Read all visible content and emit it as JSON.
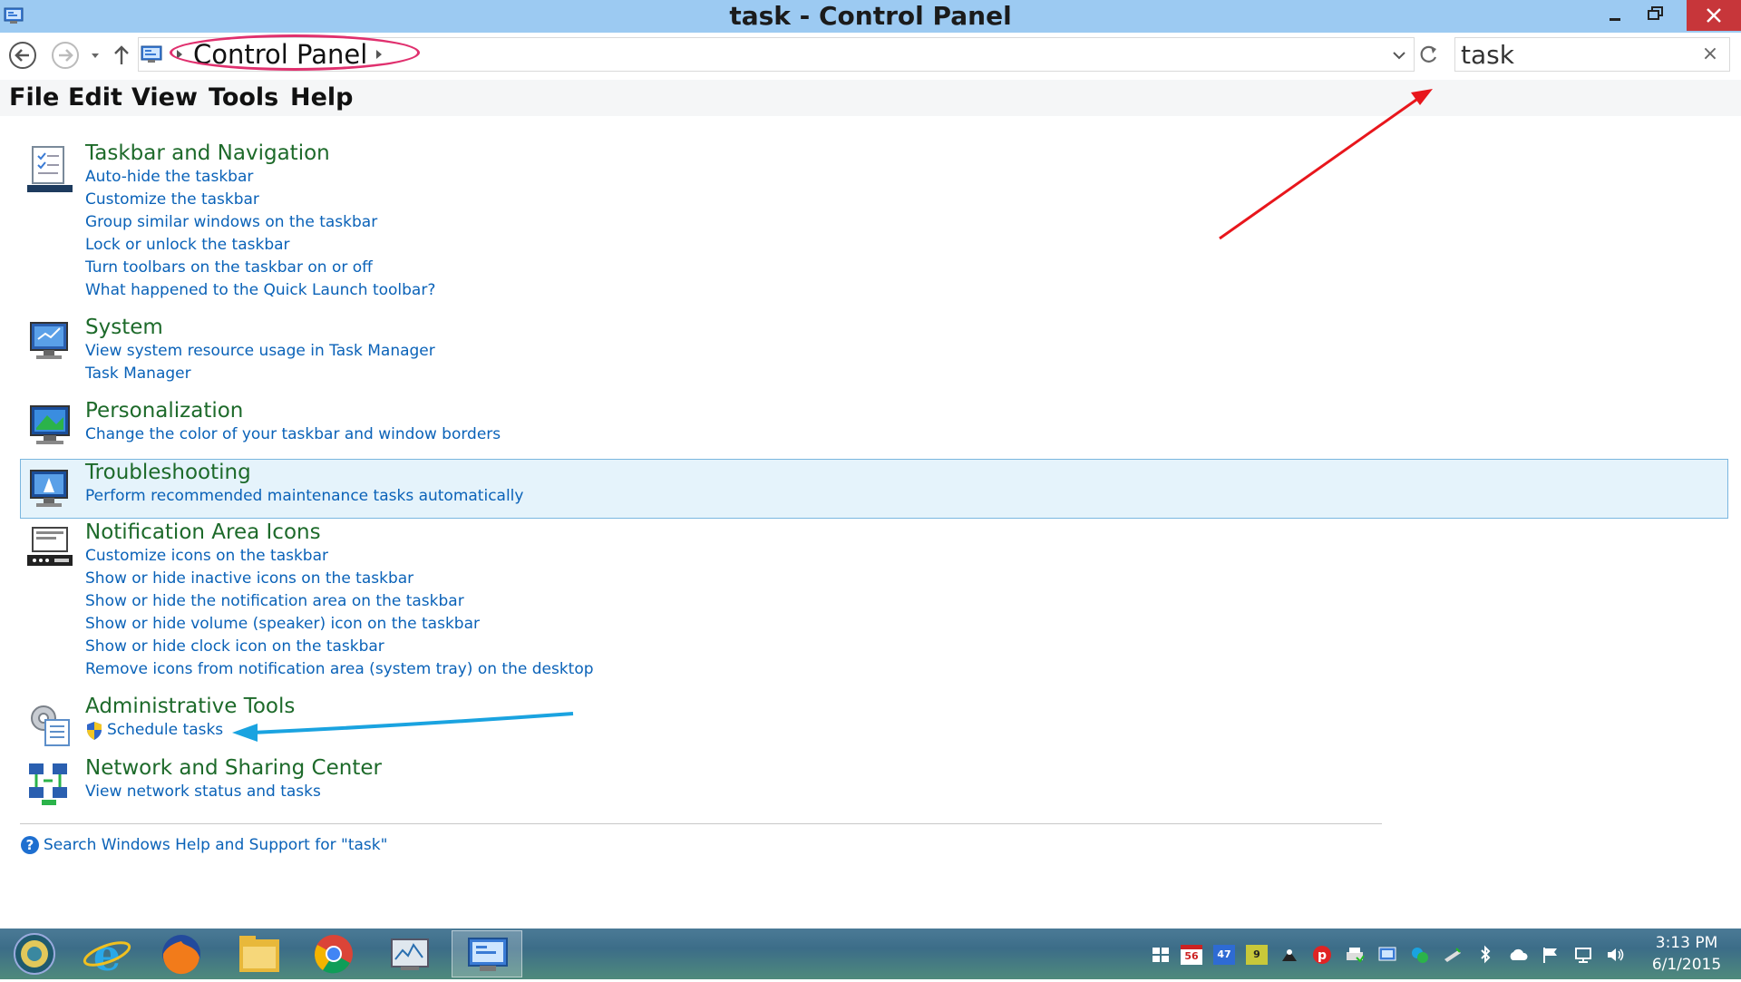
{
  "window": {
    "title": "task - Control Panel",
    "accent_titlebar": "#9ccaf2",
    "close_color": "#c7363a"
  },
  "address_bar": {
    "breadcrumb": "Control Panel",
    "annotation_color": "#e0306e"
  },
  "search": {
    "value": "task",
    "clear_glyph": "×"
  },
  "menu": {
    "file": "File",
    "edit": "Edit",
    "view": "View",
    "tools": "Tools",
    "help": "Help"
  },
  "results": [
    {
      "title": "Taskbar and Navigation",
      "icon": "taskbar-icon",
      "links": [
        "Auto-hide the taskbar",
        "Customize the taskbar",
        "Group similar windows on the taskbar",
        "Lock or unlock the taskbar",
        "Turn toolbars on the taskbar on or off",
        "What happened to the Quick Launch toolbar?"
      ]
    },
    {
      "title": "System",
      "icon": "system-icon",
      "links": [
        "View system resource usage in Task Manager",
        "Task Manager"
      ]
    },
    {
      "title": "Personalization",
      "icon": "personalization-icon",
      "links": [
        "Change the color of your taskbar and window borders"
      ]
    },
    {
      "title": "Troubleshooting",
      "icon": "troubleshooting-icon",
      "highlighted": true,
      "links": [
        "Perform recommended maintenance tasks automatically"
      ]
    },
    {
      "title": "Notification Area Icons",
      "icon": "notification-area-icon",
      "links": [
        "Customize icons on the taskbar",
        "Show or hide inactive icons on the taskbar",
        "Show or hide the notification area on the taskbar",
        "Show or hide volume (speaker) icon on the taskbar",
        "Show or hide clock icon on the taskbar",
        "Remove icons from notification area (system tray) on the desktop"
      ]
    },
    {
      "title": "Administrative Tools",
      "icon": "administrative-tools-icon",
      "links": [
        "Schedule tasks"
      ]
    },
    {
      "title": "Network and Sharing Center",
      "icon": "network-icon",
      "links": [
        "View network status and tasks"
      ]
    }
  ],
  "help_link": "Search Windows Help and Support for \"task\"",
  "colors": {
    "category_title": "#1d6a2a",
    "link": "#0a62b8",
    "highlight_bg": "#e5f3fb",
    "red_arrow": "#e8161c",
    "blue_arrow": "#1aa3e0"
  },
  "taskbar": {
    "apps": [
      "start-orb-icon",
      "internet-explorer-icon",
      "firefox-icon",
      "file-explorer-icon",
      "chrome-icon",
      "performance-monitor-icon",
      "control-panel-icon"
    ],
    "tray_badges": {
      "calendar": "56",
      "count_a": "47",
      "count_b": "9"
    },
    "clock_time": "3:13 PM",
    "clock_date": "6/1/2015"
  }
}
